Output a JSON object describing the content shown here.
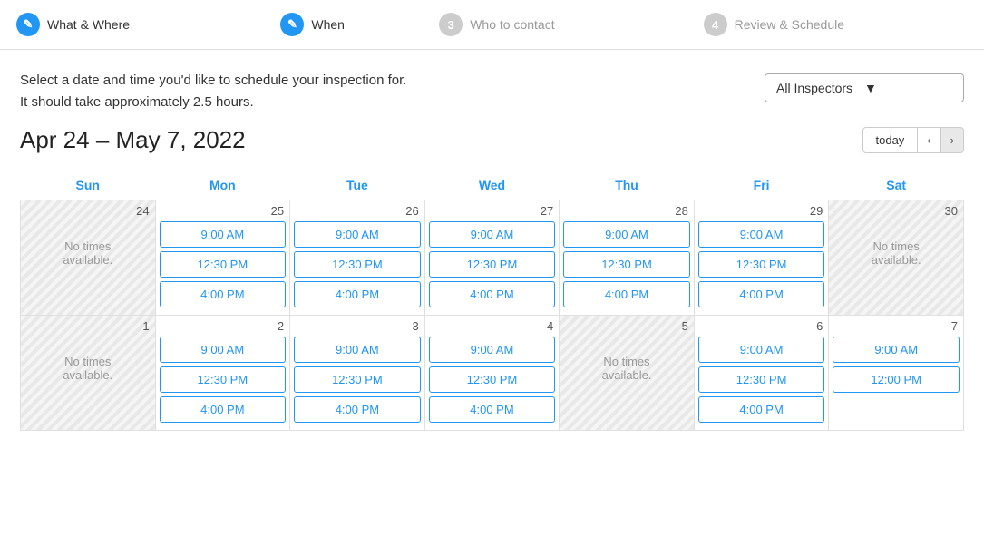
{
  "wizard": {
    "steps": [
      {
        "id": "what-where",
        "number": "✎",
        "label": "What & Where",
        "state": "active"
      },
      {
        "id": "when",
        "number": "✎",
        "label": "When",
        "state": "active"
      },
      {
        "id": "who-to-contact",
        "number": "3",
        "label": "Who to contact",
        "state": "inactive"
      },
      {
        "id": "review-schedule",
        "number": "4",
        "label": "Review & Schedule",
        "state": "inactive"
      }
    ]
  },
  "description": {
    "line1": "Select a date and time you'd like to schedule your inspection for.",
    "line2": "It should take approximately 2.5 hours."
  },
  "inspector_dropdown": {
    "label": "All Inspectors",
    "placeholder": "All Inspectors"
  },
  "date_range": {
    "label": "Apr 24 – May 7, 2022"
  },
  "nav": {
    "today_label": "today",
    "prev_label": "‹",
    "next_label": "›"
  },
  "calendar": {
    "headers": [
      "Sun",
      "Mon",
      "Tue",
      "Wed",
      "Thu",
      "Fri",
      "Sat"
    ],
    "weeks": [
      {
        "days": [
          {
            "number": "24",
            "striped": true,
            "no_times": true
          },
          {
            "number": "25",
            "striped": false,
            "times": [
              "9:00 AM",
              "12:30 PM",
              "4:00 PM"
            ]
          },
          {
            "number": "26",
            "striped": false,
            "times": [
              "9:00 AM",
              "12:30 PM",
              "4:00 PM"
            ]
          },
          {
            "number": "27",
            "striped": false,
            "times": [
              "9:00 AM",
              "12:30 PM",
              "4:00 PM"
            ]
          },
          {
            "number": "28",
            "striped": false,
            "times": [
              "9:00 AM",
              "12:30 PM",
              "4:00 PM"
            ]
          },
          {
            "number": "29",
            "striped": false,
            "times": [
              "9:00 AM",
              "12:30 PM",
              "4:00 PM"
            ]
          },
          {
            "number": "30",
            "striped": true,
            "no_times": true
          }
        ]
      },
      {
        "days": [
          {
            "number": "1",
            "striped": true,
            "no_times": true
          },
          {
            "number": "2",
            "striped": false,
            "times": [
              "9:00 AM",
              "12:30 PM",
              "4:00 PM"
            ]
          },
          {
            "number": "3",
            "striped": false,
            "times": [
              "9:00 AM",
              "12:30 PM",
              "4:00 PM"
            ]
          },
          {
            "number": "4",
            "striped": false,
            "times": [
              "9:00 AM",
              "12:30 PM",
              "4:00 PM"
            ]
          },
          {
            "number": "5",
            "striped": true,
            "no_times": true
          },
          {
            "number": "6",
            "striped": false,
            "times": [
              "9:00 AM",
              "12:30 PM",
              "4:00 PM"
            ]
          },
          {
            "number": "7",
            "striped": false,
            "times": [
              "9:00 AM",
              "12:00 PM"
            ]
          }
        ]
      }
    ],
    "no_times_text": "No times\navailable."
  },
  "colors": {
    "accent": "#2196f3",
    "inactive": "#ccc",
    "border": "#e0e0e0"
  }
}
